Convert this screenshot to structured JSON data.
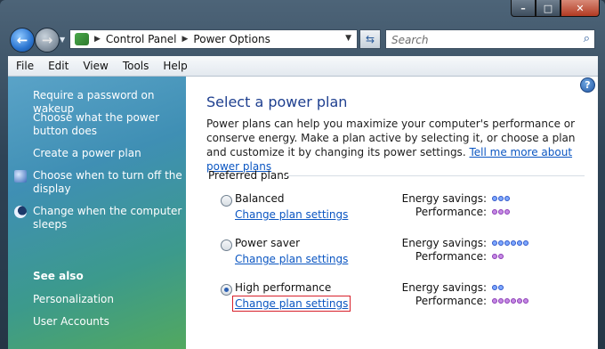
{
  "colors": {
    "link": "#0b56c2",
    "title": "#1e3f8f",
    "energy_dot": "#7ea9ff",
    "performance_dot": "#c58ae5",
    "focus_border": "#d8202a"
  },
  "address": {
    "items": [
      "Control Panel",
      "Power Options"
    ]
  },
  "search": {
    "placeholder": "Search"
  },
  "menu": [
    "File",
    "Edit",
    "View",
    "Tools",
    "Help"
  ],
  "sidebar": {
    "tasks": [
      {
        "label": "Require a password on wakeup"
      },
      {
        "label": "Choose what the power button does"
      },
      {
        "label": "Create a power plan"
      },
      {
        "label": "Choose when to turn off the display",
        "icon": "monitor-icon"
      },
      {
        "label": "Change when the computer sleeps",
        "icon": "moon-icon"
      }
    ],
    "see_also": "See also",
    "links": [
      "Personalization",
      "User Accounts"
    ]
  },
  "main": {
    "title": "Select a power plan",
    "description": "Power plans can help you maximize your computer's performance or conserve energy. Make a plan active by selecting it, or choose a plan and customize it by changing its power settings.",
    "learn_more": "Tell me more about power plans",
    "preferred_label": "Preferred plans",
    "energy_label": "Energy savings:",
    "performance_label": "Performance:",
    "change_label": "Change plan settings",
    "plans": [
      {
        "name": "Balanced",
        "energy": 3,
        "performance": 3,
        "selected": false
      },
      {
        "name": "Power saver",
        "energy": 6,
        "performance": 2,
        "selected": false
      },
      {
        "name": "High performance",
        "energy": 2,
        "performance": 6,
        "selected": true
      }
    ]
  }
}
